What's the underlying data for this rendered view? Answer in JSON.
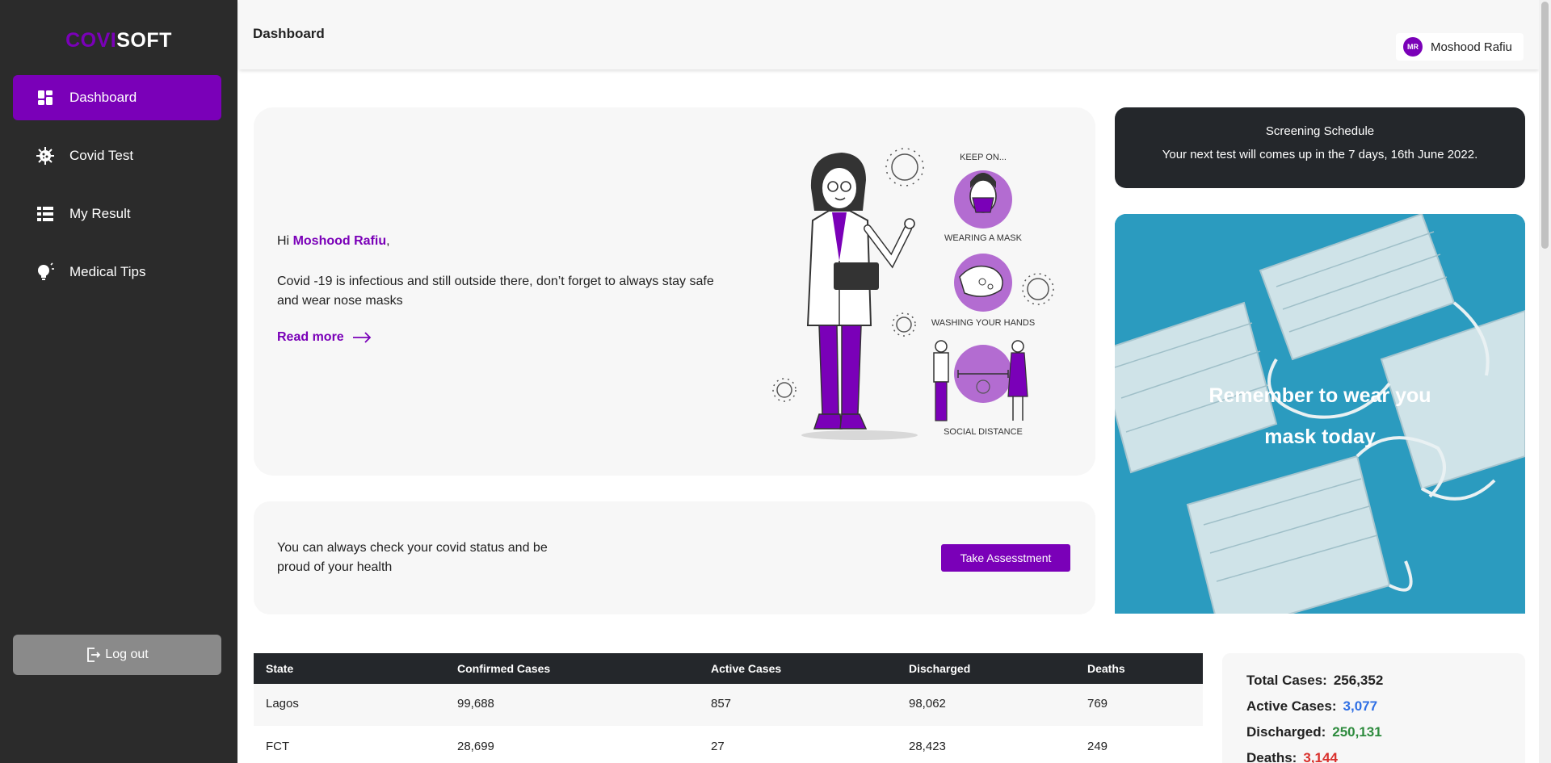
{
  "app": {
    "logo_part1": "COVI",
    "logo_part2": "SOFT"
  },
  "sidebar": {
    "items": [
      {
        "label": "Dashboard",
        "icon": "dashboard-icon",
        "active": true
      },
      {
        "label": "Covid Test",
        "icon": "virus-icon",
        "active": false
      },
      {
        "label": "My Result",
        "icon": "list-icon",
        "active": false
      },
      {
        "label": "Medical Tips",
        "icon": "lightbulb-icon",
        "active": false
      }
    ],
    "logout_label": "Log out"
  },
  "header": {
    "title": "Dashboard",
    "user_initials": "MR",
    "user_name": "Moshood Rafiu"
  },
  "hero": {
    "greeting": "Hi",
    "name": "Moshood Rafiu",
    "comma": ",",
    "message": "Covid -19 is infectious and still outside there, don’t forget to always stay safe and wear nose masks",
    "read_more": "Read more",
    "illustration": {
      "keep_on": "KEEP ON...",
      "wearing_mask": "WEARING A MASK",
      "washing_hands": "WASHING YOUR HANDS",
      "social_distance": "SOCIAL DISTANCE"
    }
  },
  "assessment": {
    "message": "You can always check your covid status and be proud of your health",
    "button": "Take Assesstment"
  },
  "screening": {
    "title": "Screening Schedule",
    "message": "Your next test will comes up in the 7 days, 16th June 2022."
  },
  "mask_card": {
    "line1": "Remember to wear you",
    "line2": "mask today"
  },
  "table": {
    "headers": [
      "State",
      "Confirmed Cases",
      "Active Cases",
      "Discharged",
      "Deaths"
    ],
    "rows": [
      [
        "Lagos",
        "99,688",
        "857",
        "98,062",
        "769"
      ],
      [
        "FCT",
        "28,699",
        "27",
        "28,423",
        "249"
      ]
    ]
  },
  "stats": {
    "total_label": "Total Cases:",
    "total_value": "256,352",
    "active_label": "Active Cases:",
    "active_value": "3,077",
    "discharged_label": "Discharged:",
    "discharged_value": "250,131",
    "deaths_label": "Deaths:",
    "deaths_value": "3,144"
  },
  "colors": {
    "brand": "#7a00b8",
    "sidebar": "#2b2b2b",
    "dark_card": "#24272b",
    "active_blue": "#2f6fe4",
    "discharged_green": "#2e8b3e",
    "deaths_red": "#d9302c"
  }
}
